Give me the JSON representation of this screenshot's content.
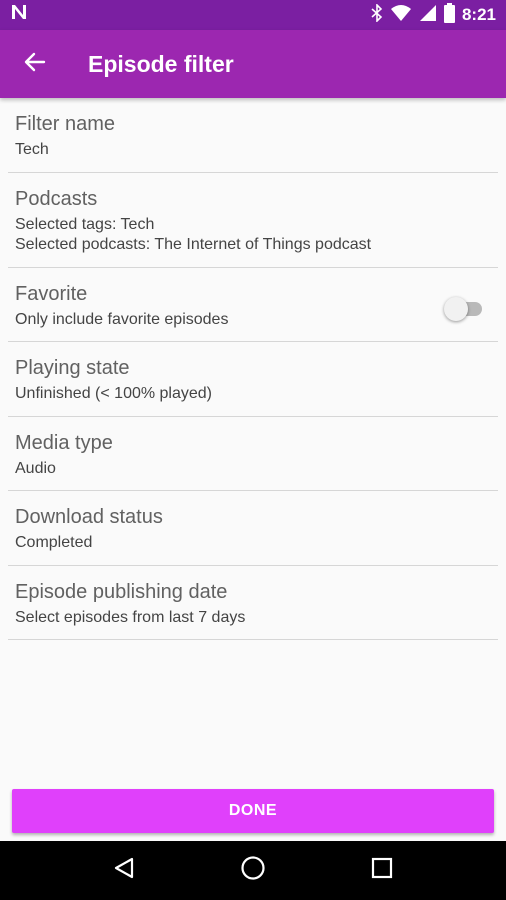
{
  "status_bar": {
    "time": "8:21"
  },
  "app_bar": {
    "title": "Episode filter"
  },
  "items": [
    {
      "title": "Filter name",
      "subtitle": "Tech"
    },
    {
      "title": "Podcasts",
      "subtitle": "Selected tags: Tech",
      "subtitle2": "Selected podcasts: The Internet of Things podcast"
    },
    {
      "title": "Favorite",
      "subtitle": "Only include favorite episodes",
      "toggle_on": false
    },
    {
      "title": "Playing state",
      "subtitle": "Unfinished (< 100% played)"
    },
    {
      "title": "Media type",
      "subtitle": "Audio"
    },
    {
      "title": "Download status",
      "subtitle": "Completed"
    },
    {
      "title": "Episode publishing date",
      "subtitle": "Select episodes from last 7 days"
    }
  ],
  "done_button": {
    "label": "DONE"
  },
  "colors": {
    "status_bar": "#7b1fa2",
    "app_bar": "#9c27b0",
    "accent": "#e040fb"
  },
  "icons": {
    "status_left": "notification-n-icon",
    "bluetooth": "bluetooth-icon",
    "wifi": "wifi-icon",
    "signal": "signal-icon",
    "battery": "battery-icon",
    "back": "arrow-left-icon",
    "nav_back": "triangle-back-icon",
    "nav_home": "circle-home-icon",
    "nav_recents": "square-recents-icon"
  }
}
